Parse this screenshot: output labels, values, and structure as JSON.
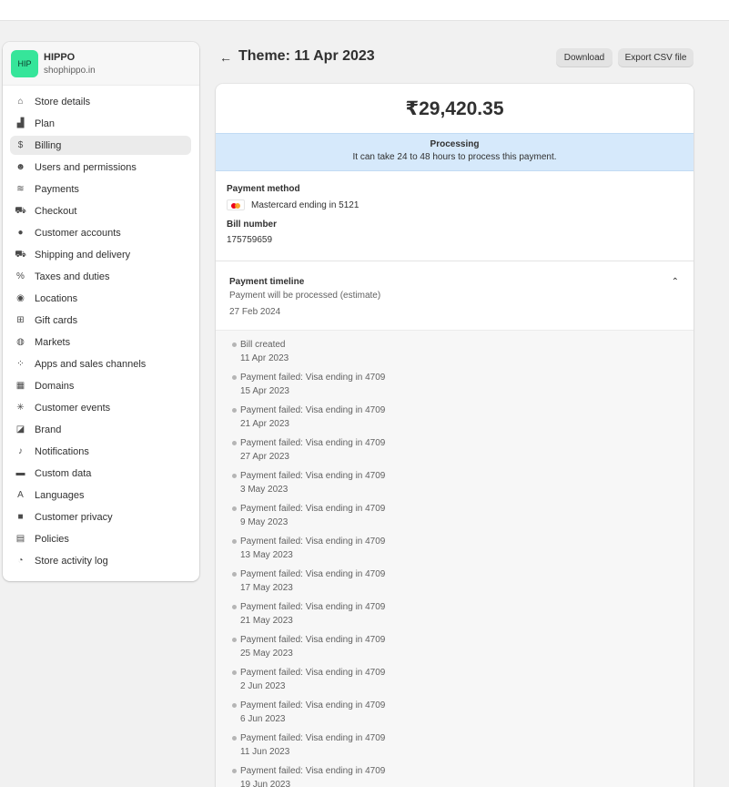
{
  "store": {
    "avatar": "HIP",
    "name": "HIPPO",
    "domain": "shophippo.in"
  },
  "sidebar": {
    "items": [
      {
        "label": "Store details",
        "icon": "store-icon",
        "glyph": "⌂"
      },
      {
        "label": "Plan",
        "icon": "plan-icon",
        "glyph": "▟"
      },
      {
        "label": "Billing",
        "icon": "billing-icon",
        "glyph": "$",
        "active": true
      },
      {
        "label": "Users and permissions",
        "icon": "users-icon",
        "glyph": "☻"
      },
      {
        "label": "Payments",
        "icon": "payments-icon",
        "glyph": "≋"
      },
      {
        "label": "Checkout",
        "icon": "cart-icon",
        "glyph": "⛟"
      },
      {
        "label": "Customer accounts",
        "icon": "person-icon",
        "glyph": "●"
      },
      {
        "label": "Shipping and delivery",
        "icon": "truck-icon",
        "glyph": "⛟"
      },
      {
        "label": "Taxes and duties",
        "icon": "tax-icon",
        "glyph": "%"
      },
      {
        "label": "Locations",
        "icon": "location-icon",
        "glyph": "◉"
      },
      {
        "label": "Gift cards",
        "icon": "gift-card-icon",
        "glyph": "⊞"
      },
      {
        "label": "Markets",
        "icon": "globe-icon",
        "glyph": "◍"
      },
      {
        "label": "Apps and sales channels",
        "icon": "apps-icon",
        "glyph": "⁘"
      },
      {
        "label": "Domains",
        "icon": "domains-icon",
        "glyph": "▦"
      },
      {
        "label": "Customer events",
        "icon": "events-icon",
        "glyph": "✳"
      },
      {
        "label": "Brand",
        "icon": "brand-icon",
        "glyph": "◪"
      },
      {
        "label": "Notifications",
        "icon": "bell-icon",
        "glyph": "♪"
      },
      {
        "label": "Custom data",
        "icon": "custom-data-icon",
        "glyph": "▬"
      },
      {
        "label": "Languages",
        "icon": "languages-icon",
        "glyph": "A"
      },
      {
        "label": "Customer privacy",
        "icon": "lock-icon",
        "glyph": "■"
      },
      {
        "label": "Policies",
        "icon": "policies-icon",
        "glyph": "▤"
      },
      {
        "label": "Store activity log",
        "icon": "activity-log-icon",
        "glyph": "◔"
      }
    ]
  },
  "header": {
    "title": "Theme: 11 Apr 2023",
    "download_label": "Download",
    "export_label": "Export CSV file"
  },
  "bill": {
    "amount": "₹29,420.35",
    "status_title": "Processing",
    "status_text": "It can take 24 to 48 hours to process this payment.",
    "payment_method_label": "Payment method",
    "payment_method_value": "Mastercard ending in 5121",
    "bill_number_label": "Bill number",
    "bill_number_value": "175759659"
  },
  "timeline": {
    "title": "Payment timeline",
    "subtitle": "Payment will be processed (estimate)",
    "date": "27 Feb 2024",
    "events": [
      {
        "title": "Bill created",
        "date": "11 Apr 2023"
      },
      {
        "title": "Payment failed: Visa ending in 4709",
        "date": "15 Apr 2023"
      },
      {
        "title": "Payment failed: Visa ending in 4709",
        "date": "21 Apr 2023"
      },
      {
        "title": "Payment failed: Visa ending in 4709",
        "date": "27 Apr 2023"
      },
      {
        "title": "Payment failed: Visa ending in 4709",
        "date": "3 May 2023"
      },
      {
        "title": "Payment failed: Visa ending in 4709",
        "date": "9 May 2023"
      },
      {
        "title": "Payment failed: Visa ending in 4709",
        "date": "13 May 2023"
      },
      {
        "title": "Payment failed: Visa ending in 4709",
        "date": "17 May 2023"
      },
      {
        "title": "Payment failed: Visa ending in 4709",
        "date": "21 May 2023"
      },
      {
        "title": "Payment failed: Visa ending in 4709",
        "date": "25 May 2023"
      },
      {
        "title": "Payment failed: Visa ending in 4709",
        "date": "2 Jun 2023"
      },
      {
        "title": "Payment failed: Visa ending in 4709",
        "date": "6 Jun 2023"
      },
      {
        "title": "Payment failed: Visa ending in 4709",
        "date": "11 Jun 2023"
      },
      {
        "title": "Payment failed: Visa ending in 4709",
        "date": "19 Jun 2023"
      }
    ]
  },
  "colors": {
    "avatar_bg": "#36e59a",
    "banner_bg": "#d6e9fb",
    "page_bg": "#f1f1f1"
  }
}
